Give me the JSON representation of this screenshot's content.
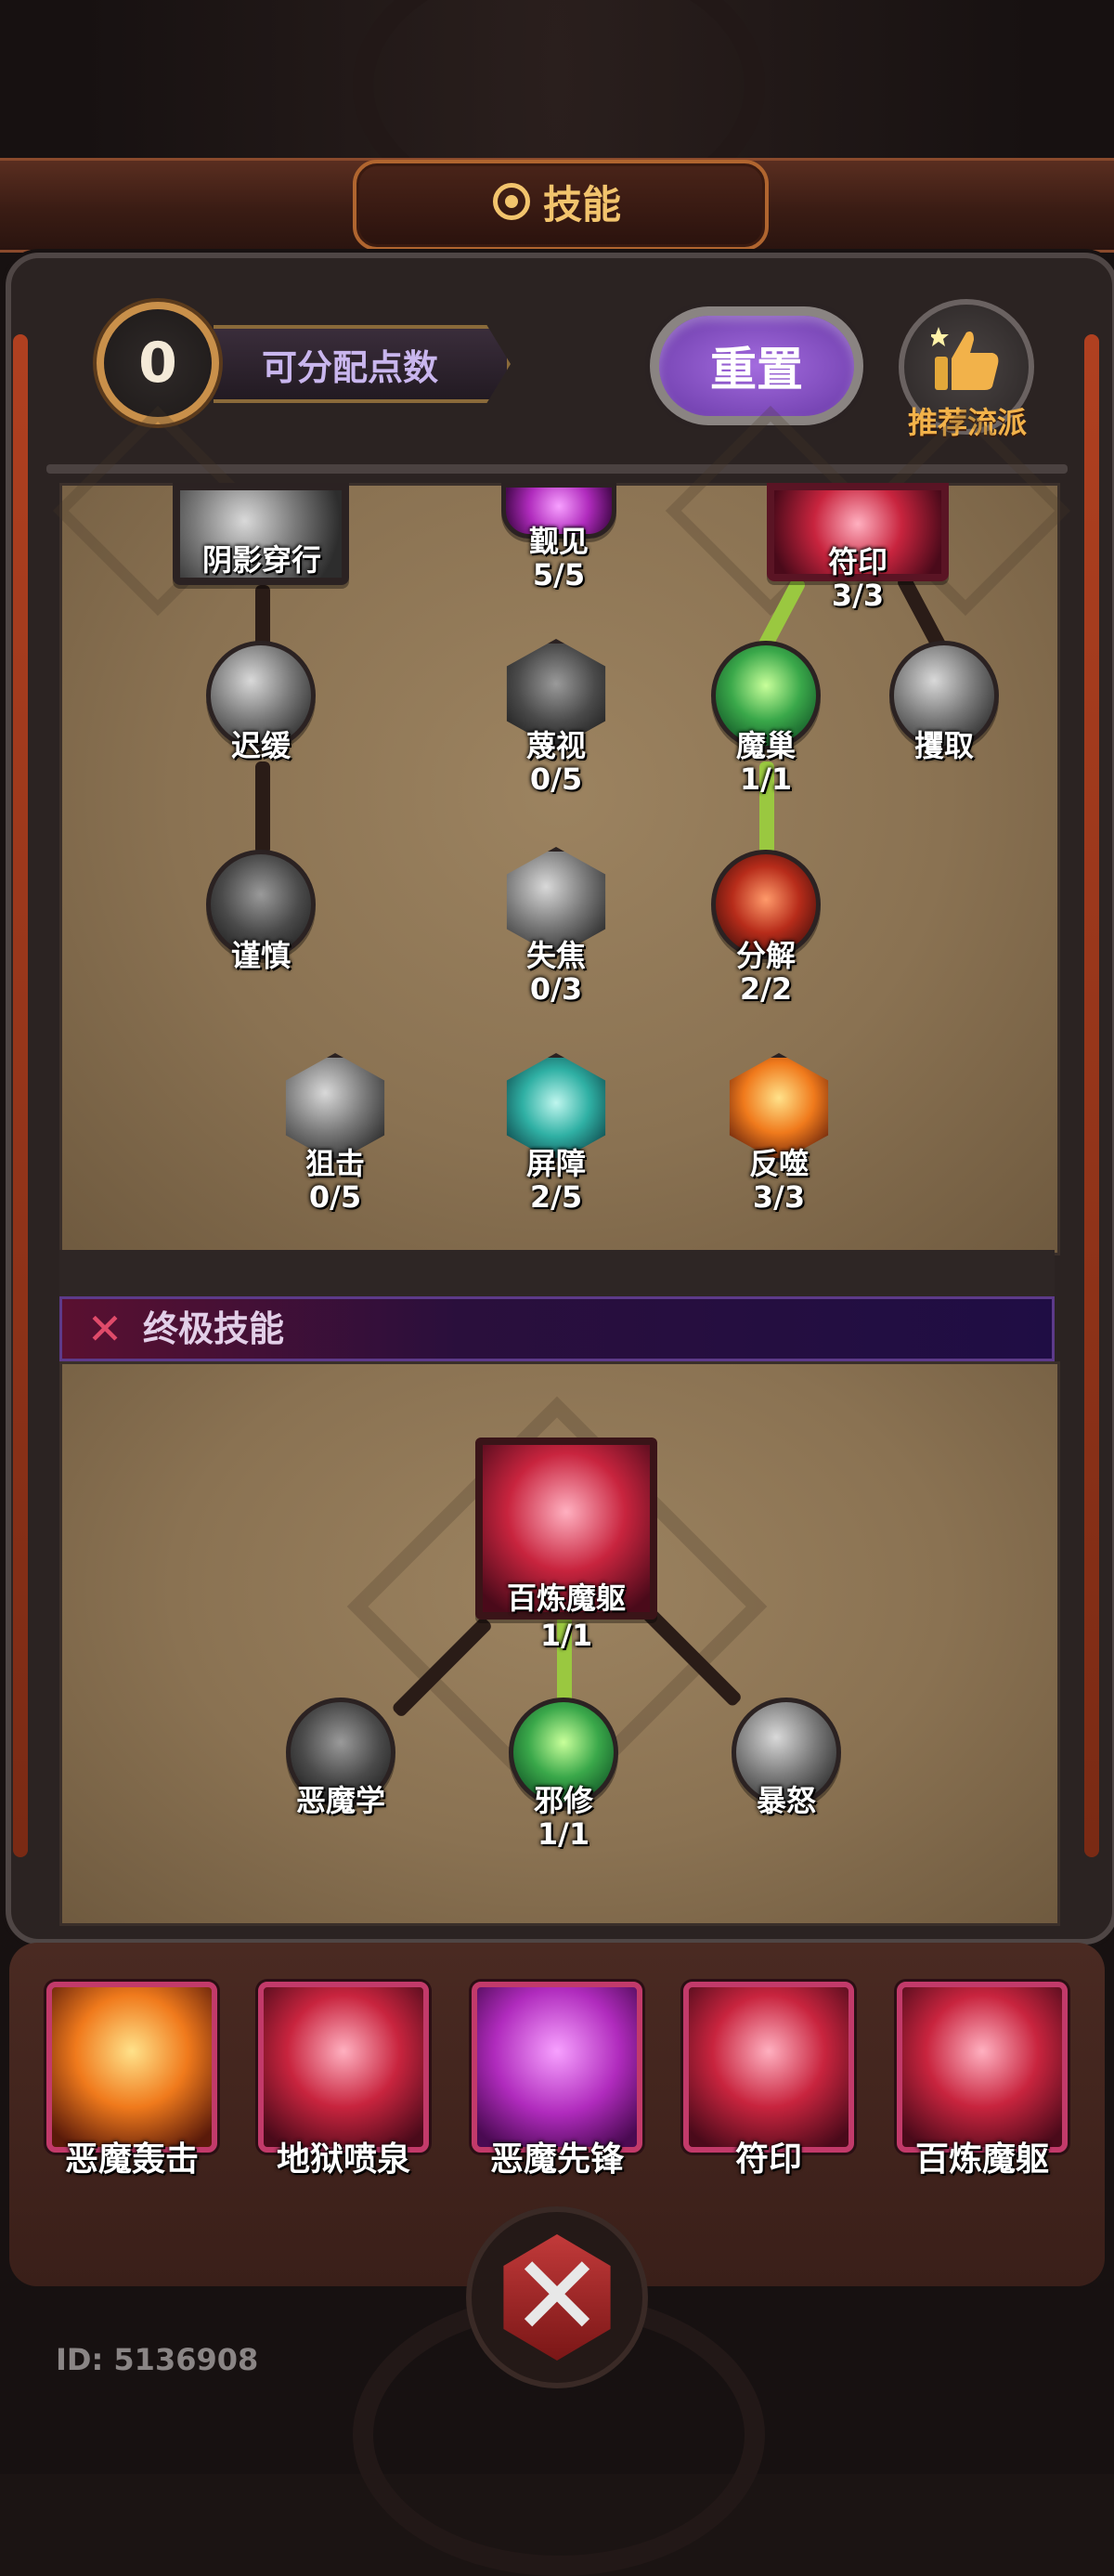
{
  "header": {
    "title": "技能"
  },
  "top_bar": {
    "points_value": "0",
    "points_label": "可分配点数",
    "reset_label": "重置",
    "recommend_label": "推荐流派"
  },
  "skill_tree": {
    "partial_row": [
      {
        "name": "阴影穿行"
      },
      {
        "name": "觐见",
        "count": "5/5"
      },
      {
        "name": "符印",
        "count": "3/3"
      }
    ],
    "row1": [
      {
        "name": "迟缓"
      },
      {
        "name": "蔑视",
        "count": "0/5"
      },
      {
        "name": "魔巢",
        "count": "1/1"
      },
      {
        "name": "攫取"
      }
    ],
    "row2": [
      {
        "name": "谨慎"
      },
      {
        "name": "失焦",
        "count": "0/3"
      },
      {
        "name": "分解",
        "count": "2/2"
      }
    ],
    "row3": [
      {
        "name": "狙击",
        "count": "0/5"
      },
      {
        "name": "屏障",
        "count": "2/5"
      },
      {
        "name": "反噬",
        "count": "3/3"
      }
    ]
  },
  "ultimate": {
    "section_title": "终极技能",
    "main": {
      "name": "百炼魔躯",
      "count": "1/1"
    },
    "branches": [
      {
        "name": "恶魔学"
      },
      {
        "name": "邪修",
        "count": "1/1"
      },
      {
        "name": "暴怒"
      }
    ]
  },
  "equipped": [
    {
      "name": "恶魔轰击",
      "icon": "demon-blast-icon"
    },
    {
      "name": "地狱喷泉",
      "icon": "hell-fountain-icon"
    },
    {
      "name": "恶魔先锋",
      "icon": "demon-vanguard-icon"
    },
    {
      "name": "符印",
      "icon": "sigil-icon"
    },
    {
      "name": "百炼魔躯",
      "icon": "demon-body-icon"
    }
  ],
  "footer": {
    "user_id": "ID: 5136908"
  },
  "colors": {
    "accent_gold": "#f2c46d",
    "reset_purple": "#8a4fd0",
    "active_link": "#9ac840",
    "slot_border": "#c23a6a"
  }
}
